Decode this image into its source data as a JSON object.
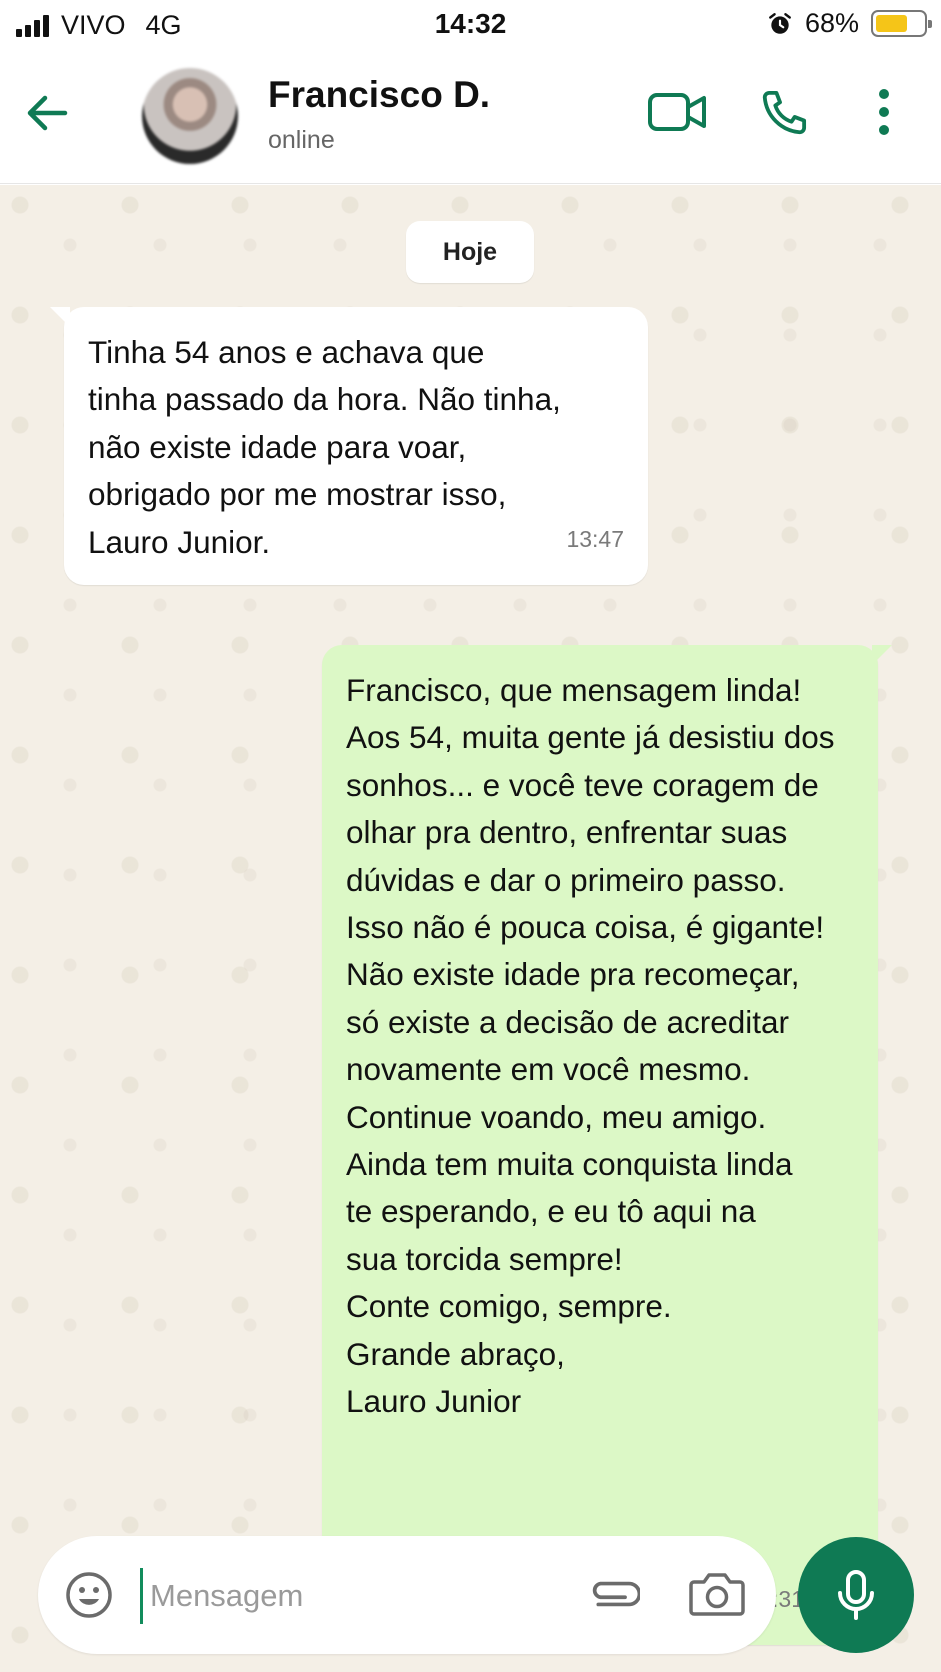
{
  "status_bar": {
    "carrier": "VIVO",
    "network": "4G",
    "time": "14:32",
    "battery_percent": "68%",
    "battery_level": 0.68,
    "alarm_icon": "alarm-clock-icon"
  },
  "header": {
    "contact_name": "Francisco D.",
    "contact_status": "online",
    "icons": [
      "back-arrow-icon",
      "video-call-icon",
      "phone-icon",
      "more-vert-icon"
    ]
  },
  "chat": {
    "date_chip": "Hoje",
    "messages": [
      {
        "direction": "incoming",
        "text": "Tinha 54 anos e achava que\ntinha passado da hora. Não tinha,\nnão existe idade para voar,\nobrigado por me mostrar isso,\nLauro Junior.",
        "time": "13:47"
      },
      {
        "direction": "outgoing",
        "text": "Francisco, que mensagem linda!\nAos 54, muita gente já desistiu dos\nsonhos... e você teve coragem de\nolhar pra dentro, enfrentar suas\ndúvidas e dar o primeiro passo.\nIsso não é pouca coisa, é gigante!\nNão existe idade pra recomeçar,\nsó existe a decisão de acreditar\nnovamente em você mesmo.\nContinue voando, meu amigo.\nAinda tem muita conquista linda\nte esperando, e eu tô aqui na\nsua torcida sempre!\nConte comigo, sempre.\nGrande abraço,\nLauro Junior",
        "time": "14:31",
        "read_receipt": "double-check-icon"
      }
    ]
  },
  "composer": {
    "placeholder": "Mensagem",
    "value": "",
    "icons": [
      "emoji-icon",
      "attach-icon",
      "camera-icon",
      "mic-icon"
    ]
  },
  "colors": {
    "accent": "#0f7a54",
    "outgoing_bubble": "#dcf8c6",
    "incoming_bubble": "#ffffff",
    "chat_background": "#f4efe6",
    "read_tick": "#34b7f1",
    "battery_fill": "#f5c518"
  }
}
